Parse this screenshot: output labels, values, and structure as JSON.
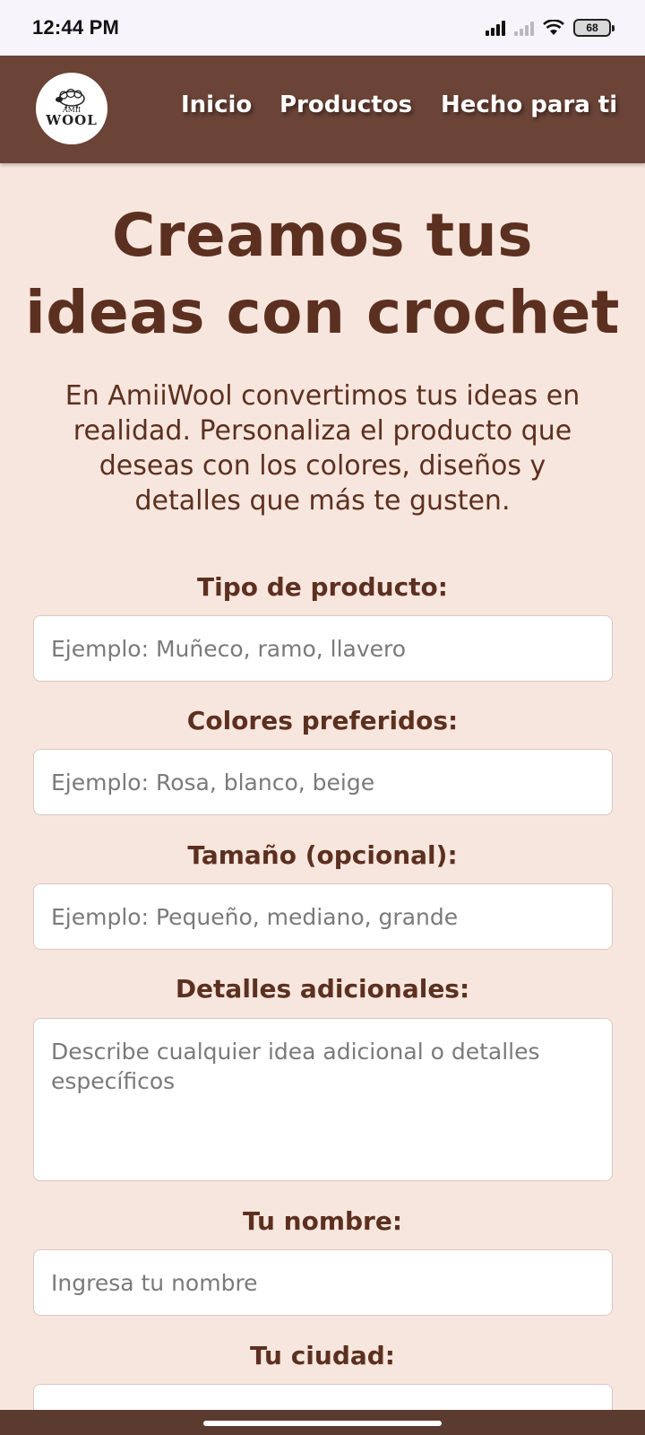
{
  "status_bar": {
    "time": "12:44 PM",
    "battery": "68"
  },
  "header": {
    "logo": {
      "small_text": "AMII",
      "big_text": "WOOL"
    },
    "nav": [
      {
        "label": "Inicio"
      },
      {
        "label": "Productos"
      },
      {
        "label": "Hecho para ti"
      }
    ]
  },
  "hero": {
    "title_line1": "Creamos tus",
    "title_line2": "ideas con crochet",
    "intro": "En AmiiWool convertimos tus ideas en realidad. Personaliza el producto que deseas con los colores, diseños y detalles que más te gusten."
  },
  "form": {
    "fields": [
      {
        "label": "Tipo de producto:",
        "placeholder": "Ejemplo: Muñeco, ramo, llavero"
      },
      {
        "label": "Colores preferidos:",
        "placeholder": "Ejemplo: Rosa, blanco, beige"
      },
      {
        "label": "Tamaño (opcional):",
        "placeholder": "Ejemplo: Pequeño, mediano, grande"
      },
      {
        "label": "Detalles adicionales:",
        "placeholder": "Describe cualquier idea adicional o detalles específicos"
      },
      {
        "label": "Tu nombre:",
        "placeholder": "Ingresa tu nombre"
      },
      {
        "label": "Tu ciudad:",
        "placeholder": ""
      }
    ]
  },
  "colors": {
    "background": "#f7e6dd",
    "header": "#6b4337",
    "text": "#5c3020"
  }
}
